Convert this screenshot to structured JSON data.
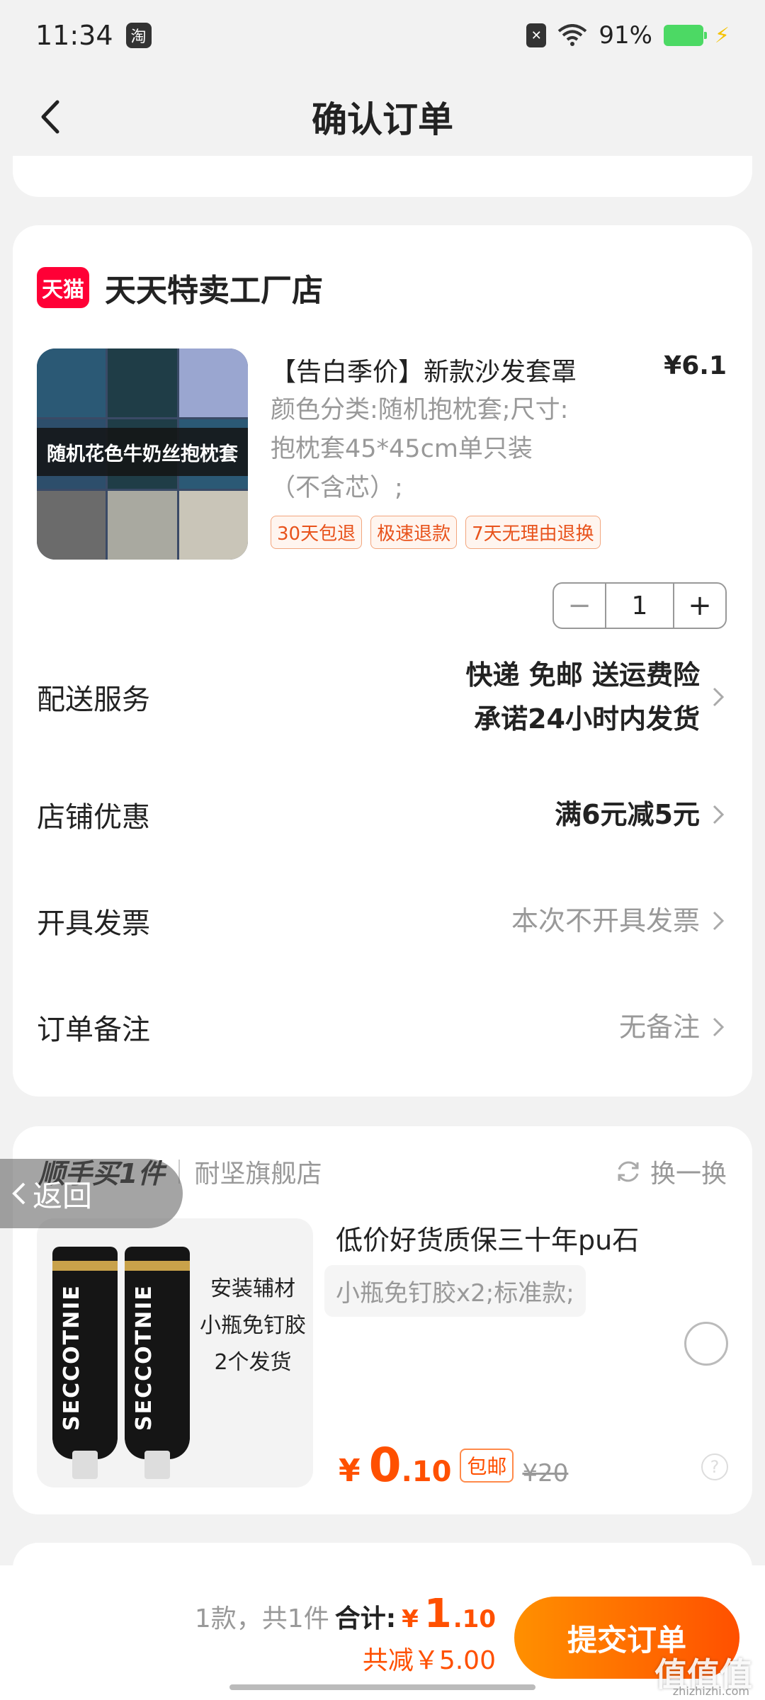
{
  "status_bar": {
    "time": "11:34",
    "app_badge": "淘",
    "battery": "91%",
    "colors": {
      "battery": "#4cd964"
    }
  },
  "nav": {
    "title": "确认订单"
  },
  "shop": {
    "platform_badge": "天猫",
    "name": "天天特卖工厂店",
    "product": {
      "title": "【告白季价】新款沙发套罩",
      "price": "¥6.1",
      "spec_line1": "颜色分类:随机抱枕套;尺寸:",
      "spec_line2": "抱枕套45*45cm单只装",
      "spec_line3": "（不含芯）;",
      "image_banner": "随机花色牛奶丝抱枕套",
      "tags": [
        "30天包退",
        "极速退款",
        "7天无理由退换"
      ],
      "quantity": "1",
      "minus": "−",
      "plus": "+"
    },
    "rows": {
      "delivery": {
        "label": "配送服务",
        "value_line1": "快递 免邮 送运费险",
        "value_line2": "承诺24小时内发货"
      },
      "discount": {
        "label": "店铺优惠",
        "value": "满6元减5元"
      },
      "invoice": {
        "label": "开具发票",
        "value": "本次不开具发票"
      },
      "remark": {
        "label": "订单备注",
        "value": "无备注"
      }
    }
  },
  "addon": {
    "title": "顺手买1件",
    "store": "耐坚旗舰店",
    "swap": "换一换",
    "back": "返回",
    "product": {
      "name": "低价好货质保三十年pu石",
      "spec": "小瓶免钉胶x2;标准款;",
      "image_brand": "SECCOTNIE",
      "image_text": "安装辅材 小瓶免钉胶 2个发货",
      "price_symbol": "¥",
      "price_int": "0",
      "price_dec": ".10",
      "badge": "包邮",
      "original_price": "¥20"
    }
  },
  "bottom_bar": {
    "count_text": "1款，共1件",
    "total_label": "合计:",
    "total_symbol": "¥",
    "total_int": "1",
    "total_dec": ".10",
    "saved_text": "共减￥5.00",
    "submit": "提交订单",
    "colors": {
      "accent": "#ff5000"
    }
  },
  "watermark": {
    "main": "值值值",
    "sub": "zhizhizhi.com"
  }
}
